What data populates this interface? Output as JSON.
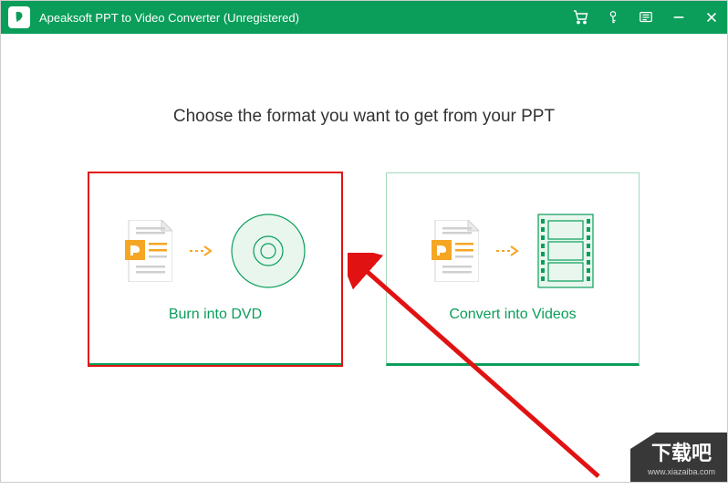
{
  "window": {
    "title": "Apeaksoft PPT to Video Converter (Unregistered)"
  },
  "main": {
    "heading": "Choose the format you want to get from your PPT",
    "options": [
      {
        "label": "Burn into DVD",
        "selected": true
      },
      {
        "label": "Convert into Videos",
        "selected": false
      }
    ]
  },
  "watermark": {
    "line1": "下载吧",
    "url": "www.xiazaiba.com"
  },
  "colors": {
    "brand_green": "#0a9e5a",
    "accent_orange": "#f5a623",
    "annotation_red": "#e11212"
  }
}
